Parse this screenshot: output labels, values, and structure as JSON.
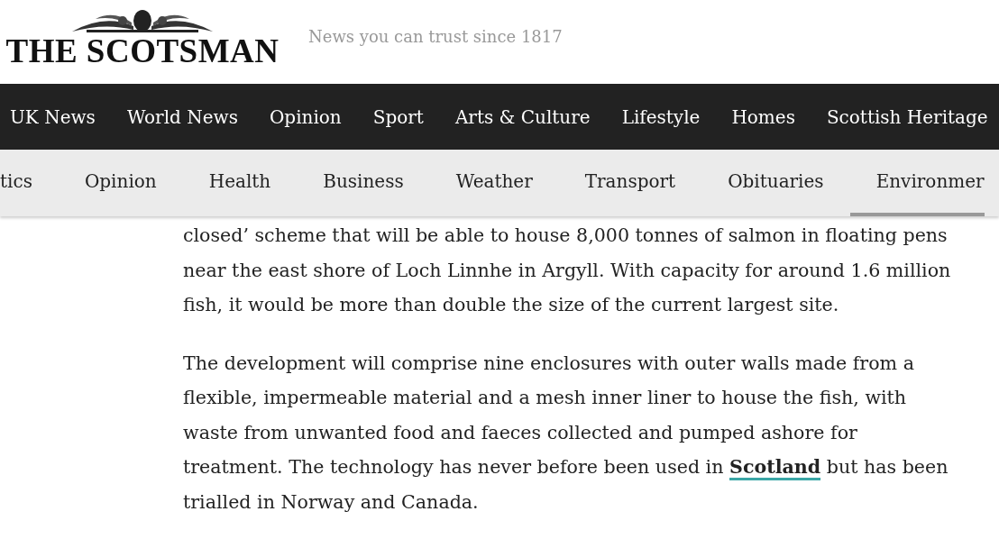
{
  "header": {
    "logo": "THE SCOTSMAN",
    "tagline": "News you can trust since 1817"
  },
  "main_nav": [
    {
      "label": "UK News"
    },
    {
      "label": "World News"
    },
    {
      "label": "Opinion"
    },
    {
      "label": "Sport"
    },
    {
      "label": "Arts & Culture"
    },
    {
      "label": "Lifestyle"
    },
    {
      "label": "Homes"
    },
    {
      "label": "Scottish Heritage"
    }
  ],
  "sub_nav": [
    {
      "label": "tics",
      "selected": false
    },
    {
      "label": "Opinion",
      "selected": false
    },
    {
      "label": "Health",
      "selected": false
    },
    {
      "label": "Business",
      "selected": false
    },
    {
      "label": "Weather",
      "selected": false
    },
    {
      "label": "Transport",
      "selected": false
    },
    {
      "label": "Obituaries",
      "selected": false
    },
    {
      "label": "Environmer",
      "selected": true
    }
  ],
  "article": {
    "paragraphs": [
      "closed’ scheme that will be able to house 8,000 tonnes of salmon in floating pens near the east shore of Loch Linnhe in Argyll. With capacity for around 1.6 million fish, it would be more than double the size of the current largest site.",
      [
        {
          "text": "The development will comprise nine enclosures with outer walls made from a flexible, impermeable material and a mesh inner liner to house the fish, with waste from unwanted food and faeces collected and pumped ashore for treatment. The technology has never before been used in "
        },
        {
          "text": "Scotland",
          "link": true
        },
        {
          "text": " but has been trialled in Norway and Canada."
        }
      ]
    ]
  }
}
